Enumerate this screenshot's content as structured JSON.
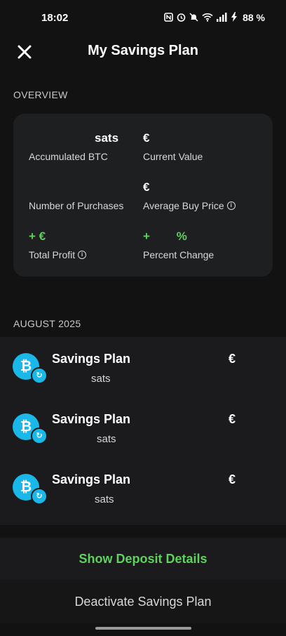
{
  "status_bar": {
    "time": "18:02",
    "battery": "88 %",
    "icons": [
      "nfc-icon",
      "alarm-icon",
      "mute-icon",
      "wifi-icon",
      "signal-icon",
      "battery-charging-icon"
    ]
  },
  "header": {
    "title": "My Savings Plan",
    "close_icon": "close-icon"
  },
  "overview": {
    "section_label": "OVERVIEW",
    "accumulated_btc": {
      "value": "sats",
      "label": "Accumulated BTC"
    },
    "current_value": {
      "value": "€",
      "label": "Current Value"
    },
    "number_of_purchases": {
      "value": "",
      "label": "Number of Purchases"
    },
    "average_buy_price": {
      "value": "€",
      "label": "Average Buy Price"
    },
    "total_profit": {
      "value": "+ €",
      "label": "Total Profit"
    },
    "percent_change": {
      "value": "+        %",
      "label": "Percent Change"
    }
  },
  "transactions": {
    "section_label": "AUGUST 2025",
    "items": [
      {
        "title": "Savings Plan",
        "subtitle": "sats",
        "amount": "€"
      },
      {
        "title": "Savings Plan",
        "subtitle": "sats",
        "amount": "€"
      },
      {
        "title": "Savings Plan",
        "subtitle": "sats",
        "amount": "€"
      }
    ]
  },
  "actions": {
    "deposit_label": "Show Deposit Details",
    "deactivate_label": "Deactivate Savings Plan"
  },
  "colors": {
    "background": "#121212",
    "card": "#1e1f21",
    "accent_green": "#5ed15e",
    "bitcoin_blue": "#1ab8e8"
  }
}
